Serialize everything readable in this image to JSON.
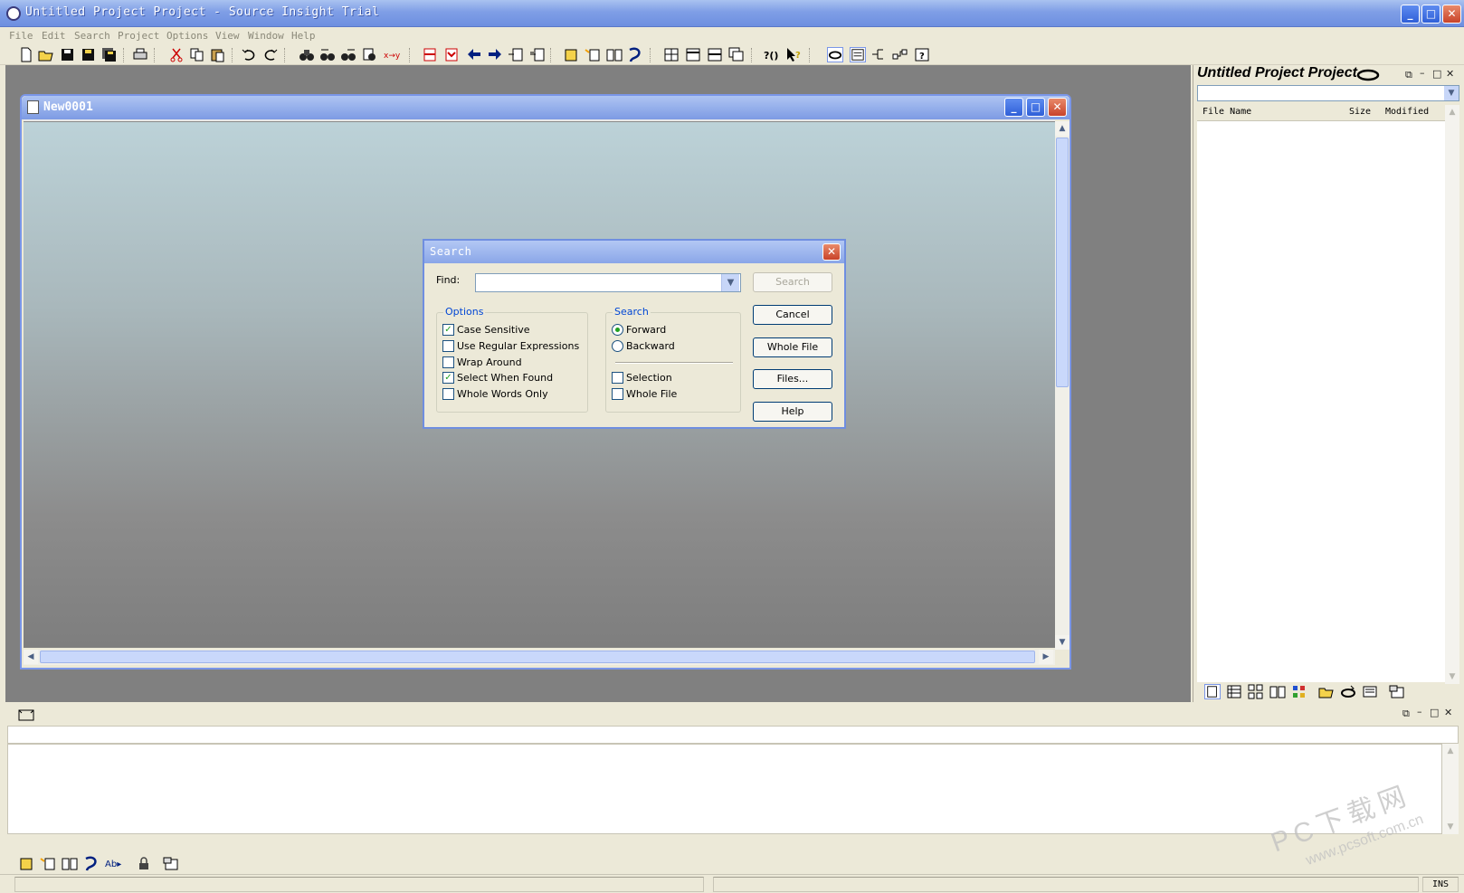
{
  "window": {
    "title": "Untitled Project Project - Source Insight Trial",
    "minimize": "_",
    "maximize": "□",
    "close": "✕"
  },
  "menu": [
    "File",
    "Edit",
    "Search",
    "Project",
    "Options",
    "View",
    "Window",
    "Help"
  ],
  "toolbar_icons": [
    "new-file",
    "open-file",
    "save",
    "save-all",
    "save-copy",
    "print",
    "cut",
    "copy",
    "paste",
    "undo",
    "redo",
    "find",
    "find-prev",
    "find-next",
    "find-files",
    "replace",
    "bookmark",
    "bookmark-next",
    "go-back",
    "go-forward",
    "jump-in",
    "jump-out",
    "symbol-window",
    "relation",
    "browse",
    "reference",
    "tile",
    "split-h",
    "split-v",
    "cascade",
    "lookup",
    "context-help",
    "project",
    "project-window",
    "relation-graph",
    "symbol-layout",
    "help"
  ],
  "document": {
    "title": "New0001"
  },
  "search_dialog": {
    "title": "Search",
    "find_label": "Find:",
    "find_value": "",
    "options_group": "Options",
    "options": [
      {
        "label": "Case Sensitive",
        "checked": true
      },
      {
        "label": "Use Regular Expressions",
        "checked": false
      },
      {
        "label": "Wrap Around",
        "checked": false
      },
      {
        "label": "Select When Found",
        "checked": true
      },
      {
        "label": "Whole Words Only",
        "checked": false
      }
    ],
    "search_group": "Search",
    "direction": [
      {
        "label": "Forward",
        "selected": true
      },
      {
        "label": "Backward",
        "selected": false
      }
    ],
    "scope": [
      {
        "label": "Selection",
        "checked": false
      },
      {
        "label": "Whole File",
        "checked": false
      }
    ],
    "buttons": {
      "search": "Search",
      "cancel": "Cancel",
      "whole_file": "Whole File",
      "files": "Files...",
      "help": "Help"
    }
  },
  "project_panel": {
    "title": "Untitled Project Project",
    "columns": [
      "File Name",
      "Size",
      "Modified"
    ]
  },
  "status": {
    "mode": "INS"
  },
  "watermark": {
    "line1": "PC下载网",
    "line2": "www.pcsoft.com.cn"
  }
}
